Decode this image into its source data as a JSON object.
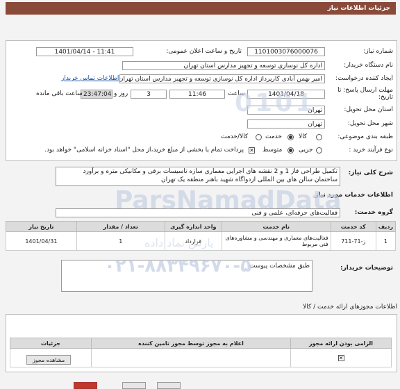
{
  "header": {
    "title": "جزئیات اطلاعات نیاز"
  },
  "form": {
    "need_number_label": "شماره نیاز:",
    "need_number": "1101003076000076",
    "announce_label": "تاریخ و ساعت اعلان عمومی:",
    "announce_value": "1401/04/14 - 11:41",
    "buyer_label": "نام دستگاه خریدار:",
    "buyer_value": "اداره کل نوسازی  توسعه و تجهیز مدارس استان تهران",
    "requester_label": "ایجاد کننده درخواست:",
    "requester_value": "امیر بهمن آبادی کارپرداز اداره کل نوسازی  توسعه و تجهیز مدارس استان تهران",
    "contact_link": "اطلاعات تماس خریدار",
    "deadline_label": "مهلت ارسال پاسخ: تا",
    "deadline_label2": "تاریخ:",
    "deadline_date": "1401/04/18",
    "time_label": "ساعت",
    "deadline_time": "11:46",
    "days_value": "3",
    "days_label": "روز و",
    "remaining_time": "23:47:04",
    "remaining_label": "ساعت باقی مانده",
    "province_label": "استان محل تحویل:",
    "province_value": "تهران",
    "city_label": "شهر محل تحویل:",
    "city_value": "تهران",
    "category_label": "طبقه بندی موضوعی:",
    "category_options": [
      "کالا",
      "خدمت",
      "کالا/خدمت"
    ],
    "process_label": "نوع فرآیند خرید :",
    "process_options": [
      "جزیی",
      "متوسط"
    ],
    "payment_note": "پرداخت تمام یا بخشی از مبلغ خرید،از محل \"اسناد خزانه اسلامی\" خواهد بود.",
    "description_label": "شرح کلی نیاز:",
    "description_value": "تکمیل طراحی فاز 1 و 2 نقشه های اجرایی معماری سازه  تاسیسات برقی و مکانیکی  متره و برآورد ساختمان سالن های بین المللی ازدواگاه شهید باهنر منطقه یک تهران"
  },
  "services": {
    "section_title": "اطلاعات خدمات مورد نیاز",
    "group_label": "گروه خدمت:",
    "group_value": "فعالیت‌های حرفه‌ای، علمی و فنی",
    "columns": [
      "ردیف",
      "کد خدمت",
      "نام خدمت",
      "واحد اندازه گیری",
      "تعداد / مقدار",
      "تاریخ نیاز"
    ],
    "rows": [
      [
        "1",
        "ز-71-711",
        "فعالیت‌های معماری و مهندسی و مشاوره‌های فنی مربوط",
        "قرارداد",
        "1",
        "1401/04/31"
      ]
    ]
  },
  "buyer_notes": {
    "label": "توضیحات خریدار:",
    "value": "طبق مشخصات پیوست"
  },
  "permits": {
    "section_title": "اطلاعات مجوزهای ارائه خدمت / کالا",
    "columns": [
      "الزامی بودن ارائه مجوز",
      "اعلام به مجوز توسط مجوز تامین کننده",
      "جزئیات"
    ],
    "view_button": "مشاهده مجوز"
  },
  "watermark": {
    "line1": "0101",
    "line2": "ParsNamadData",
    "line3": "۰۲۱-۸۸۳۴۹۶۷۰-۵",
    "brand": "پارس نماد داده"
  }
}
